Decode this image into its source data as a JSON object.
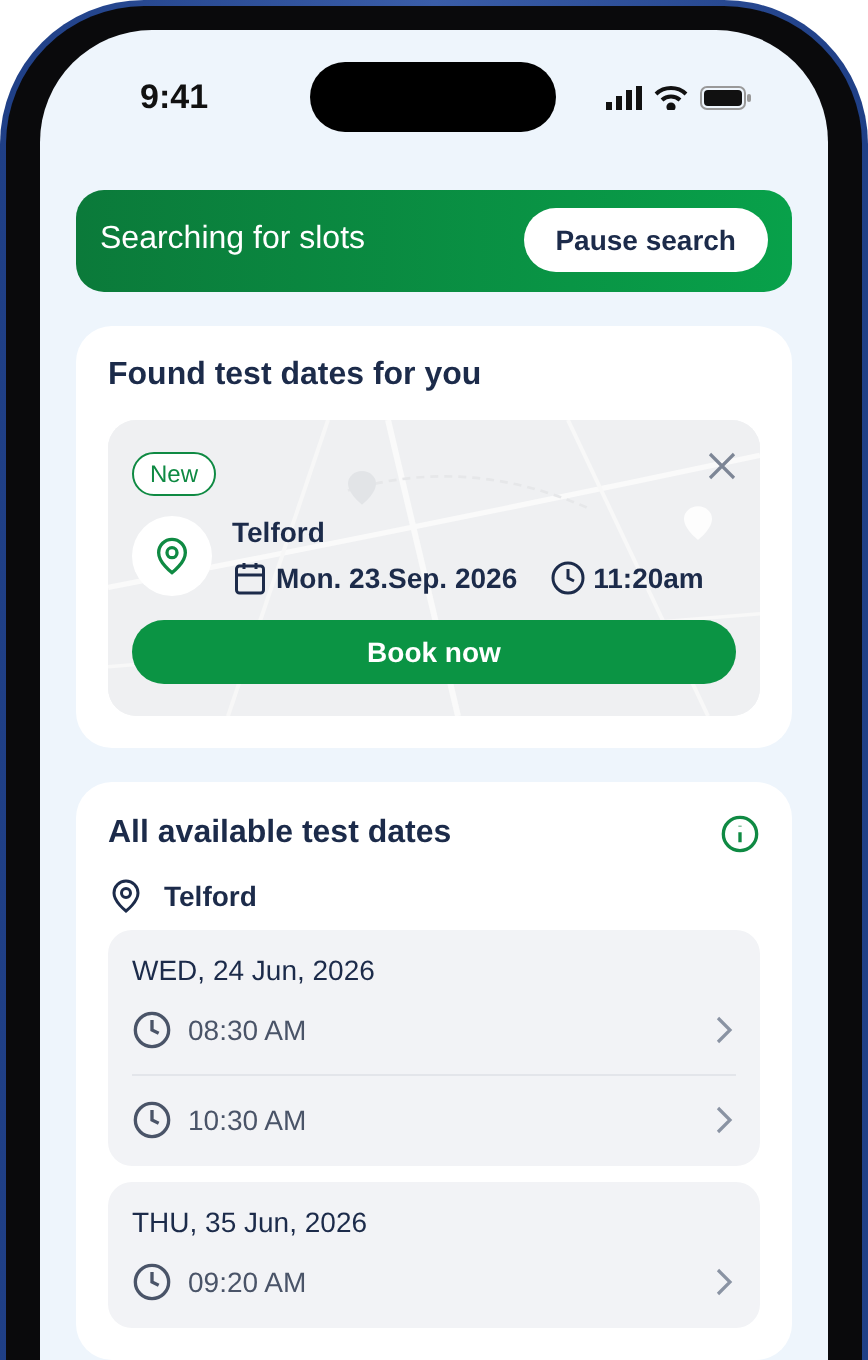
{
  "status_bar": {
    "time": "9:41"
  },
  "search_banner": {
    "label": "Searching for slots",
    "button": "Pause search"
  },
  "found_card": {
    "title": "Found test dates for you",
    "slot": {
      "badge": "New",
      "location": "Telford",
      "date": "Mon. 23.Sep. 2026",
      "time": "11:20am",
      "button": "Book now"
    }
  },
  "available_card": {
    "title": "All available test dates",
    "location": "Telford",
    "days": [
      {
        "date": "WED, 24 Jun, 2026",
        "times": [
          "08:30 AM",
          "10:30 AM"
        ]
      },
      {
        "date": "THU, 35 Jun, 2026",
        "times": [
          "09:20 AM"
        ]
      }
    ]
  }
}
